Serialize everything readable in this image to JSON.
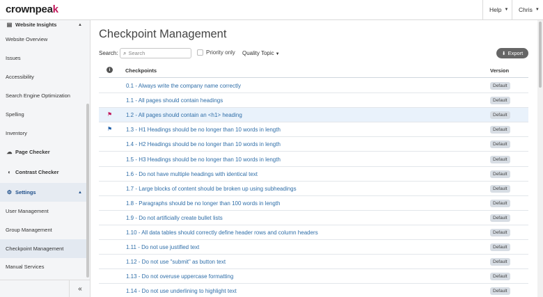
{
  "header": {
    "logo_main": "crownpea",
    "logo_accent": "k",
    "help_label": "Help",
    "user_label": "Chris"
  },
  "sidebar": {
    "items": [
      {
        "label": "Website Insights",
        "icon": "insights-icon",
        "type": "section-top"
      },
      {
        "label": "Website Overview"
      },
      {
        "label": "Issues"
      },
      {
        "label": "Accessibility"
      },
      {
        "label": "Search Engine Optimization"
      },
      {
        "label": "Spelling"
      },
      {
        "label": "Inventory"
      },
      {
        "label": "Page Checker",
        "icon": "cloud-upload-icon"
      },
      {
        "label": "Contrast Checker",
        "icon": "contrast-icon"
      },
      {
        "label": "Settings",
        "icon": "gear-icon",
        "type": "section"
      },
      {
        "label": "User Management"
      },
      {
        "label": "Group Management"
      },
      {
        "label": "Checkpoint Management",
        "active": true
      },
      {
        "label": "Manual Services"
      }
    ],
    "collapse_glyph": "«"
  },
  "main": {
    "title": "Checkpoint Management",
    "search_label": "Search:",
    "search_placeholder": "Search",
    "priority_only_label": "Priority only",
    "quality_topic_label": "Quality Topic",
    "export_label": "Export",
    "table": {
      "headers": {
        "info": "i",
        "checkpoints": "Checkpoints",
        "version": "Version"
      },
      "rows": [
        {
          "text": "0.1 - Always write the company name correctly",
          "version": "Default",
          "flag": ""
        },
        {
          "text": "1.1 - All pages should contain headings",
          "version": "Default",
          "flag": ""
        },
        {
          "text": "1.2 - All pages should contain an <h1> heading",
          "version": "Default",
          "flag": "red",
          "highlight": true
        },
        {
          "text": "1.3 - H1 Headings should be no longer than 10 words in length",
          "version": "Default",
          "flag": "blue"
        },
        {
          "text": "1.4 - H2 Headings should be no longer than 10 words in length",
          "version": "Default",
          "flag": ""
        },
        {
          "text": "1.5 - H3 Headings should be no longer than 10 words in length",
          "version": "Default",
          "flag": ""
        },
        {
          "text": "1.6 - Do not have multiple headings with identical text",
          "version": "Default",
          "flag": ""
        },
        {
          "text": "1.7 - Large blocks of content should be broken up using subheadings",
          "version": "Default",
          "flag": ""
        },
        {
          "text": "1.8 - Paragraphs should be no longer than 100 words in length",
          "version": "Default",
          "flag": ""
        },
        {
          "text": "1.9 - Do not artificially create bullet lists",
          "version": "Default",
          "flag": ""
        },
        {
          "text": "1.10 - All data tables should correctly define header rows and column headers",
          "version": "Default",
          "flag": ""
        },
        {
          "text": "1.11 - Do not use justified text",
          "version": "Default",
          "flag": ""
        },
        {
          "text": "1.12 - Do not use \"submit\" as button text",
          "version": "Default",
          "flag": ""
        },
        {
          "text": "1.13 - Do not overuse uppercase formatting",
          "version": "Default",
          "flag": ""
        },
        {
          "text": "1.14 - Do not use underlining to highlight text",
          "version": "Default",
          "flag": ""
        }
      ]
    }
  },
  "colors": {
    "brand_accent": "#c2185b",
    "link": "#2f6ea8",
    "flag_blue": "#1f5fa8",
    "highlight_row": "#e9f2fb"
  }
}
